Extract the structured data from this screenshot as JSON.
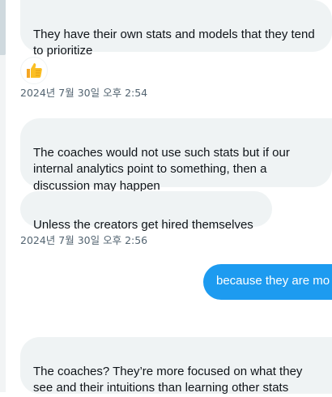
{
  "messages": [
    {
      "text": "They have their own stats and models that they tend\nto prioritize",
      "direction": "incoming"
    },
    {
      "text": "The coaches would not use such stats but if our\ninternal analytics point to something, then a\ndiscussion may happen",
      "direction": "incoming"
    },
    {
      "text": "Unless the creators get hired themselves",
      "direction": "incoming"
    },
    {
      "text": "because they are mo",
      "direction": "outgoing"
    },
    {
      "text": "The coaches? They’re more focused on what they\nsee and their intuitions than learning other stats",
      "direction": "incoming"
    }
  ],
  "timestamps": {
    "first": "2024년 7월 30일 오후 2:54",
    "second": "2024년 7월 30일 오후 2:56"
  },
  "reaction": {
    "icon": "thumbs-up-icon"
  },
  "colors": {
    "incoming_bubble": "#eff3f4",
    "outgoing_bubble": "#1d9bf0",
    "timestamp_text": "#536471",
    "reaction_yellow": "#fbbf24"
  }
}
